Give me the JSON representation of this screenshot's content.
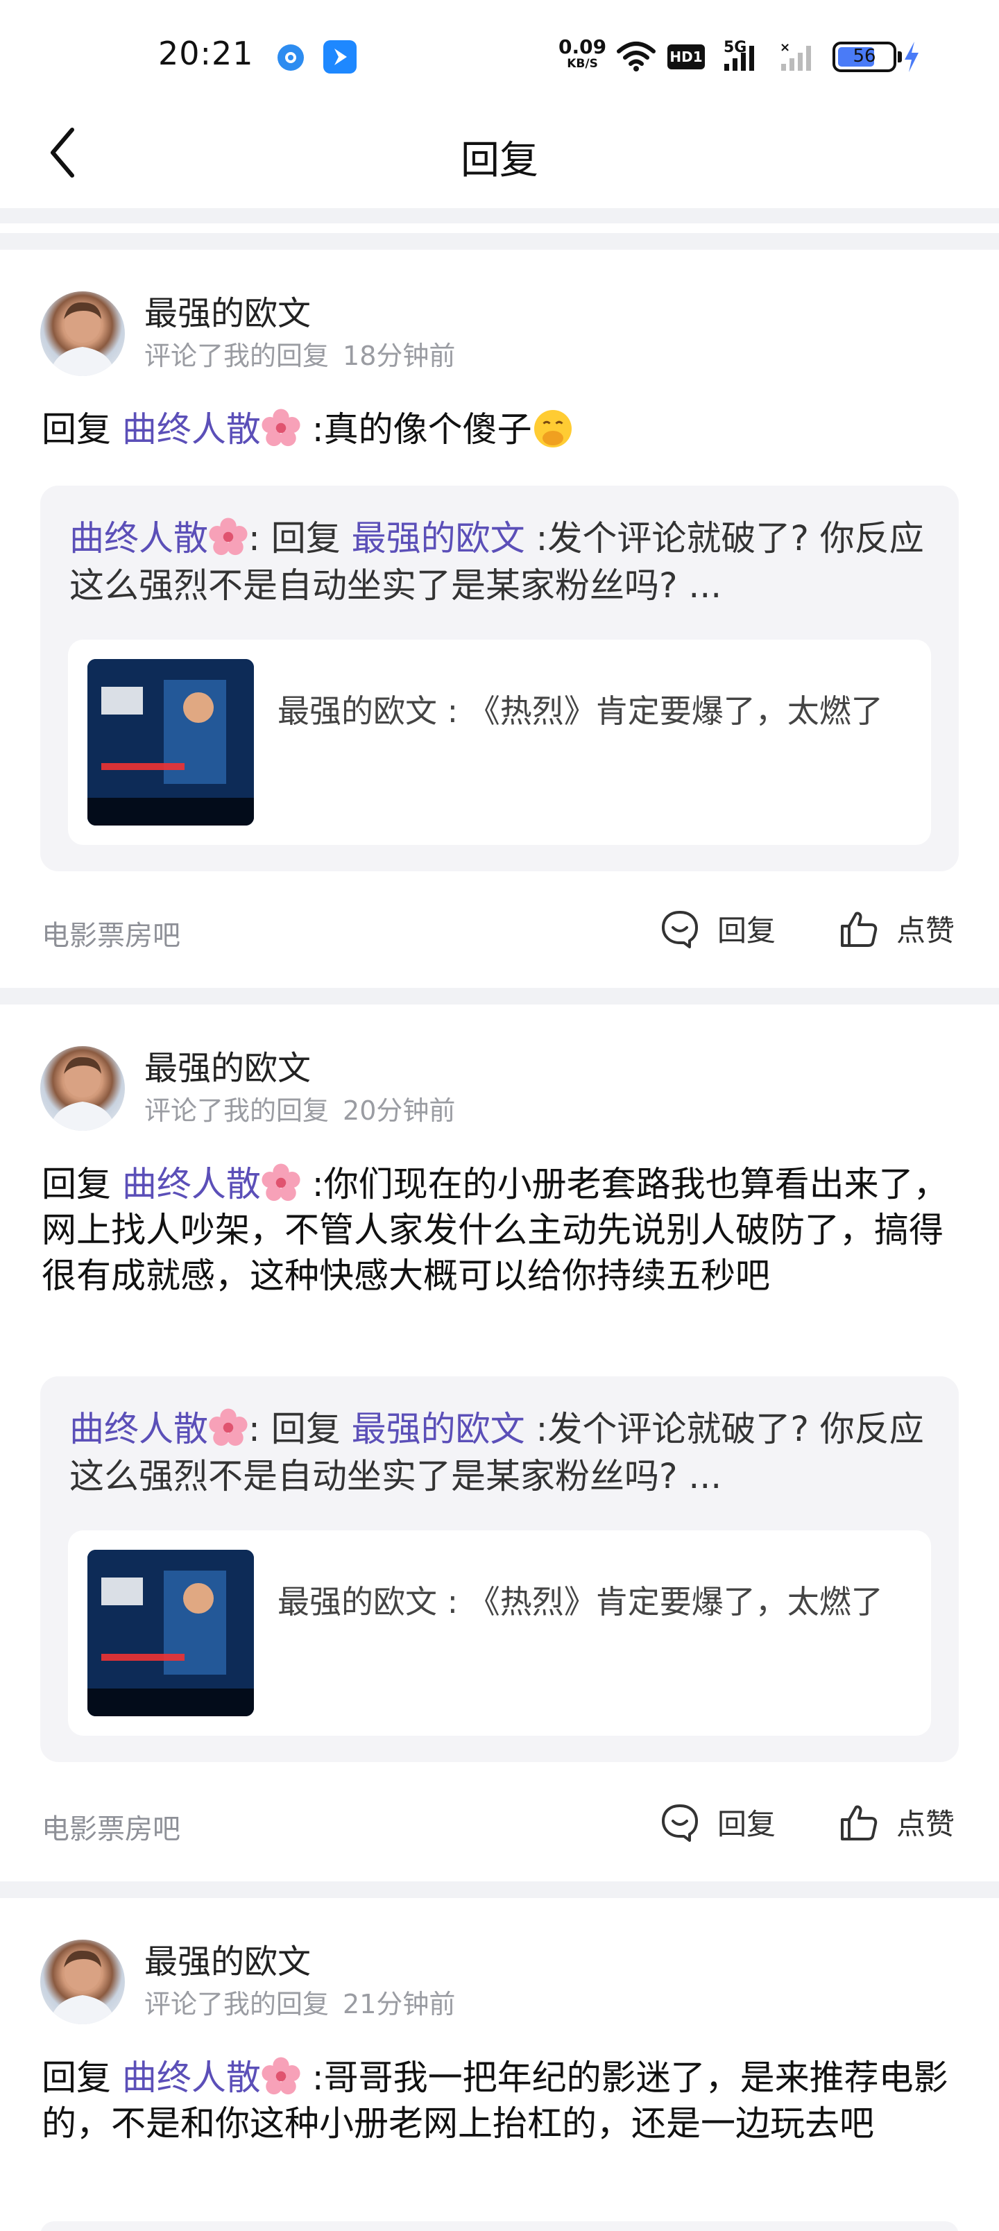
{
  "status_bar": {
    "time": "20:21",
    "net_speed_value": "0.09",
    "net_speed_unit": "KB/S",
    "hd_badge": "HD1",
    "network": "5G",
    "battery": "56",
    "icons": [
      "app-notification-icon",
      "app-notification-icon-2",
      "wifi-icon",
      "signal-icon",
      "battery-icon",
      "charging-icon"
    ]
  },
  "header": {
    "title": "回复",
    "back_icon": "chevron-left-icon"
  },
  "colors": {
    "link": "#5b4fb8",
    "divider": "#f1f2f5",
    "quote_bg": "#f4f4f7",
    "meta": "#9a9ca2"
  },
  "posts": [
    {
      "username": "最强的欧文",
      "action": "评论了我的回复",
      "time": "18分钟前",
      "reply_prefix": "回复",
      "reply_to": "曲终人散",
      "reply_body": " :真的像个傻子",
      "quote": {
        "author": "曲终人散",
        "mid": ": 回复 ",
        "target": "最强的欧文",
        "body": " :发个评论就破了? 你反应这么强烈不是自动坐实了是某家粉丝吗? ...",
        "original_text": "最强的欧文 : 《热烈》肯定要爆了，太燃了"
      },
      "source": "电影票房吧",
      "reply_label": "回复",
      "like_label": "点赞"
    },
    {
      "username": "最强的欧文",
      "action": "评论了我的回复",
      "time": "20分钟前",
      "reply_prefix": "回复",
      "reply_to": "曲终人散",
      "reply_body": " :你们现在的小册老套路我也算看出来了，网上找人吵架，不管人家发什么主动先说别人破防了，搞得很有成就感，这种快感大概可以给你持续五秒吧",
      "quote": {
        "author": "曲终人散",
        "mid": ": 回复 ",
        "target": "最强的欧文",
        "body": " :发个评论就破了? 你反应这么强烈不是自动坐实了是某家粉丝吗? ...",
        "original_text": "最强的欧文 : 《热烈》肯定要爆了，太燃了"
      },
      "source": "电影票房吧",
      "reply_label": "回复",
      "like_label": "点赞"
    },
    {
      "username": "最强的欧文",
      "action": "评论了我的回复",
      "time": "21分钟前",
      "reply_prefix": "回复",
      "reply_to": "曲终人散",
      "reply_body": " :哥哥我一把年纪的影迷了，是来推荐电影的，不是和你这种小册老网上抬杠的，还是一边玩去吧"
    }
  ]
}
